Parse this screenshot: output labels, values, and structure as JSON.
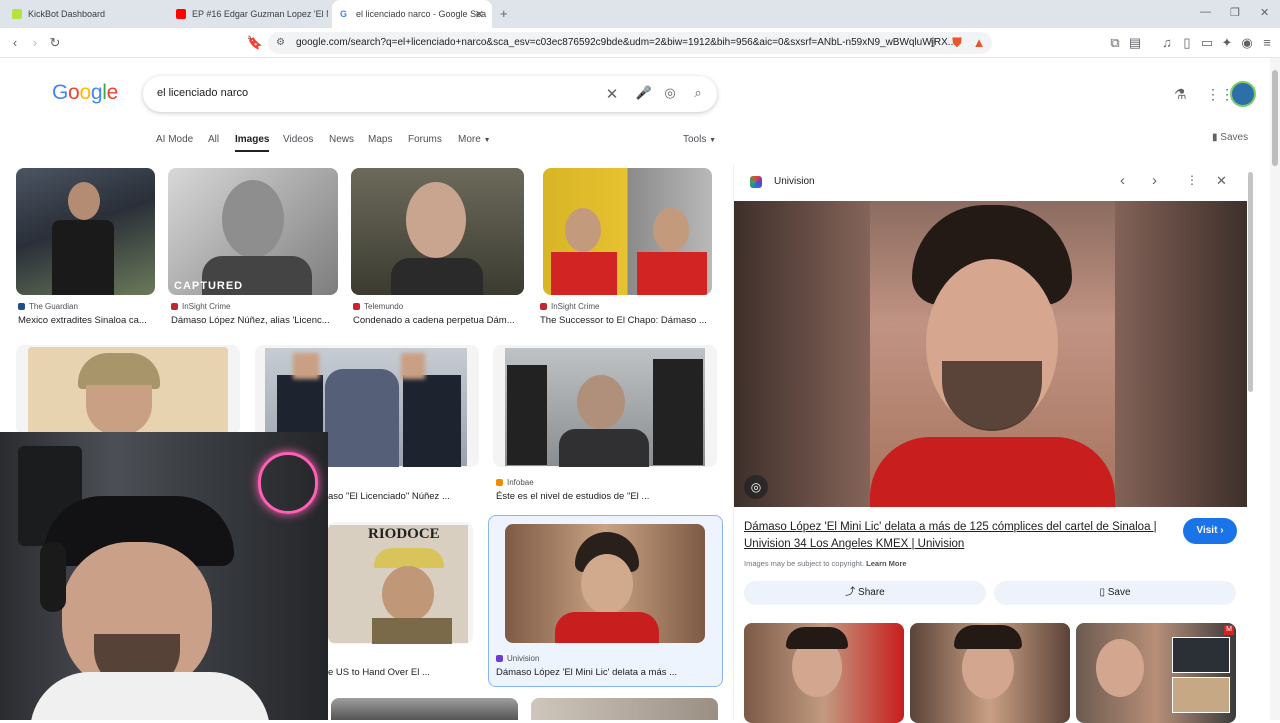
{
  "browser": {
    "tabs": [
      {
        "title": "KickBot Dashboard",
        "color": "#b4e33d"
      },
      {
        "title": "EP #16 Edgar Guzman Lopez 'El Mon",
        "color": "#ff0000"
      },
      {
        "title": "el licenciado narco - Google Sea",
        "color": "#4285f4"
      }
    ],
    "url": "google.com/search?q=el+licenciado+narco&sca_esv=c03ec876592c9bde&udm=2&biw=1912&bih=956&aic=0&sxsrf=ANbL-n59xN9_wBWqluWjRX..."
  },
  "search": {
    "logo": "Google",
    "query": "el licenciado narco",
    "nav": [
      "AI Mode",
      "All",
      "Images",
      "Videos",
      "News",
      "Maps",
      "Forums",
      "More"
    ],
    "tools": "Tools",
    "saves": "Saves"
  },
  "results": [
    {
      "source": "The Guardian",
      "caption": "Mexico extradites Sinaloa ca...",
      "color": "#1f4e8c"
    },
    {
      "source": "InSight Crime",
      "caption": "Dámaso López Núñez, alias 'Licenc...",
      "color": "#c0282d",
      "overlay": "CAPTURED"
    },
    {
      "source": "Telemundo",
      "caption": "Condenado a cadena perpetua Dám...",
      "color": "#d1202f"
    },
    {
      "source": "InSight Crime",
      "caption": "The Successor to El Chapo: Dámaso ...",
      "color": "#c0282d"
    },
    {
      "source": "",
      "caption": "aso \"El Licenciado\" Núñez ...",
      "color": "#888"
    },
    {
      "source": "Infobae",
      "caption": "Éste es el nivel de estudios de \"El ...",
      "color": "#f08a00"
    },
    {
      "source": "",
      "caption": "e US to Hand Over El ...",
      "color": "#888"
    },
    {
      "source": "Univision",
      "caption": "Dámaso López 'El Mini Lic' delata a más ...",
      "color": "#6a3ccf"
    }
  ],
  "riodoce": "RIODOCE",
  "panel": {
    "source": "Univision",
    "title_line1": "Dámaso López 'El Mini Lic' delata a más de 125 cómplices del cartel de Sinaloa |",
    "title_line2": "Univision 34 Los Angeles KMEX | Univision",
    "visit": "Visit",
    "copyright": "Images may be subject to copyright.",
    "learn_more": "Learn More",
    "share": "Share",
    "save": "Save"
  },
  "colors": {
    "accent": "#1a73e8",
    "selected_border": "#8ab4f8",
    "panel_red": "#c81e1e"
  }
}
